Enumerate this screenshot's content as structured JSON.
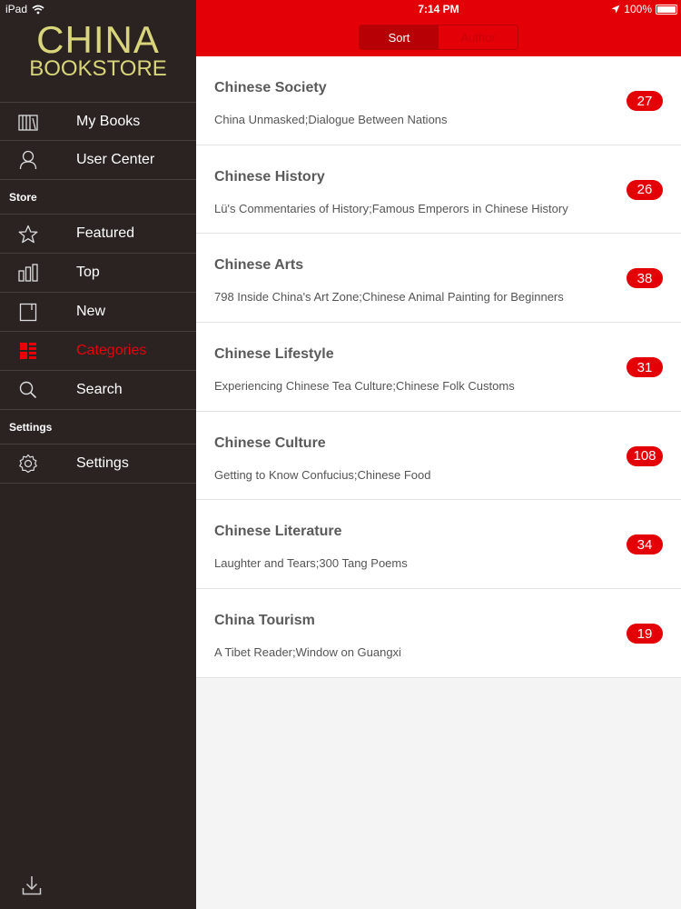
{
  "status_bar": {
    "device": "iPad",
    "time": "7:14 PM",
    "battery": "100%"
  },
  "logo": {
    "line1": "CHINA",
    "line2": "BOOKSTORE"
  },
  "sidebar": {
    "items_top": [
      {
        "label": "My Books",
        "icon": "books-icon"
      },
      {
        "label": "User Center",
        "icon": "user-icon"
      }
    ],
    "store_header": "Store",
    "store_items": [
      {
        "label": "Featured",
        "icon": "star-icon"
      },
      {
        "label": "Top",
        "icon": "bar-chart-icon"
      },
      {
        "label": "New",
        "icon": "new-book-icon"
      },
      {
        "label": "Categories",
        "icon": "grid-icon",
        "active": true
      },
      {
        "label": "Search",
        "icon": "search-icon"
      }
    ],
    "settings_header": "Settings",
    "settings_items": [
      {
        "label": "Settings",
        "icon": "gear-icon"
      }
    ]
  },
  "segmented": {
    "sort": "Sort",
    "author": "Author"
  },
  "categories": [
    {
      "title": "Chinese Society",
      "subtitle": "China Unmasked;Dialogue Between Nations",
      "count": "27"
    },
    {
      "title": "Chinese History",
      "subtitle": "Lü's Commentaries of History;Famous Emperors in Chinese History",
      "count": "26"
    },
    {
      "title": "Chinese Arts",
      "subtitle": "798 Inside China's Art Zone;Chinese Animal Painting for Beginners",
      "count": "38"
    },
    {
      "title": "Chinese Lifestyle",
      "subtitle": "Experiencing Chinese Tea Culture;Chinese Folk Customs",
      "count": "31"
    },
    {
      "title": "Chinese Culture",
      "subtitle": "Getting to Know Confucius;Chinese Food",
      "count": "108"
    },
    {
      "title": "Chinese Literature",
      "subtitle": "Laughter and Tears;300 Tang Poems",
      "count": "34"
    },
    {
      "title": "China Tourism",
      "subtitle": "A Tibet Reader;Window on Guangxi",
      "count": "19"
    }
  ],
  "colors": {
    "accent": "#e30007",
    "sidebar_bg": "#2a2322",
    "logo": "#d8d57a"
  }
}
